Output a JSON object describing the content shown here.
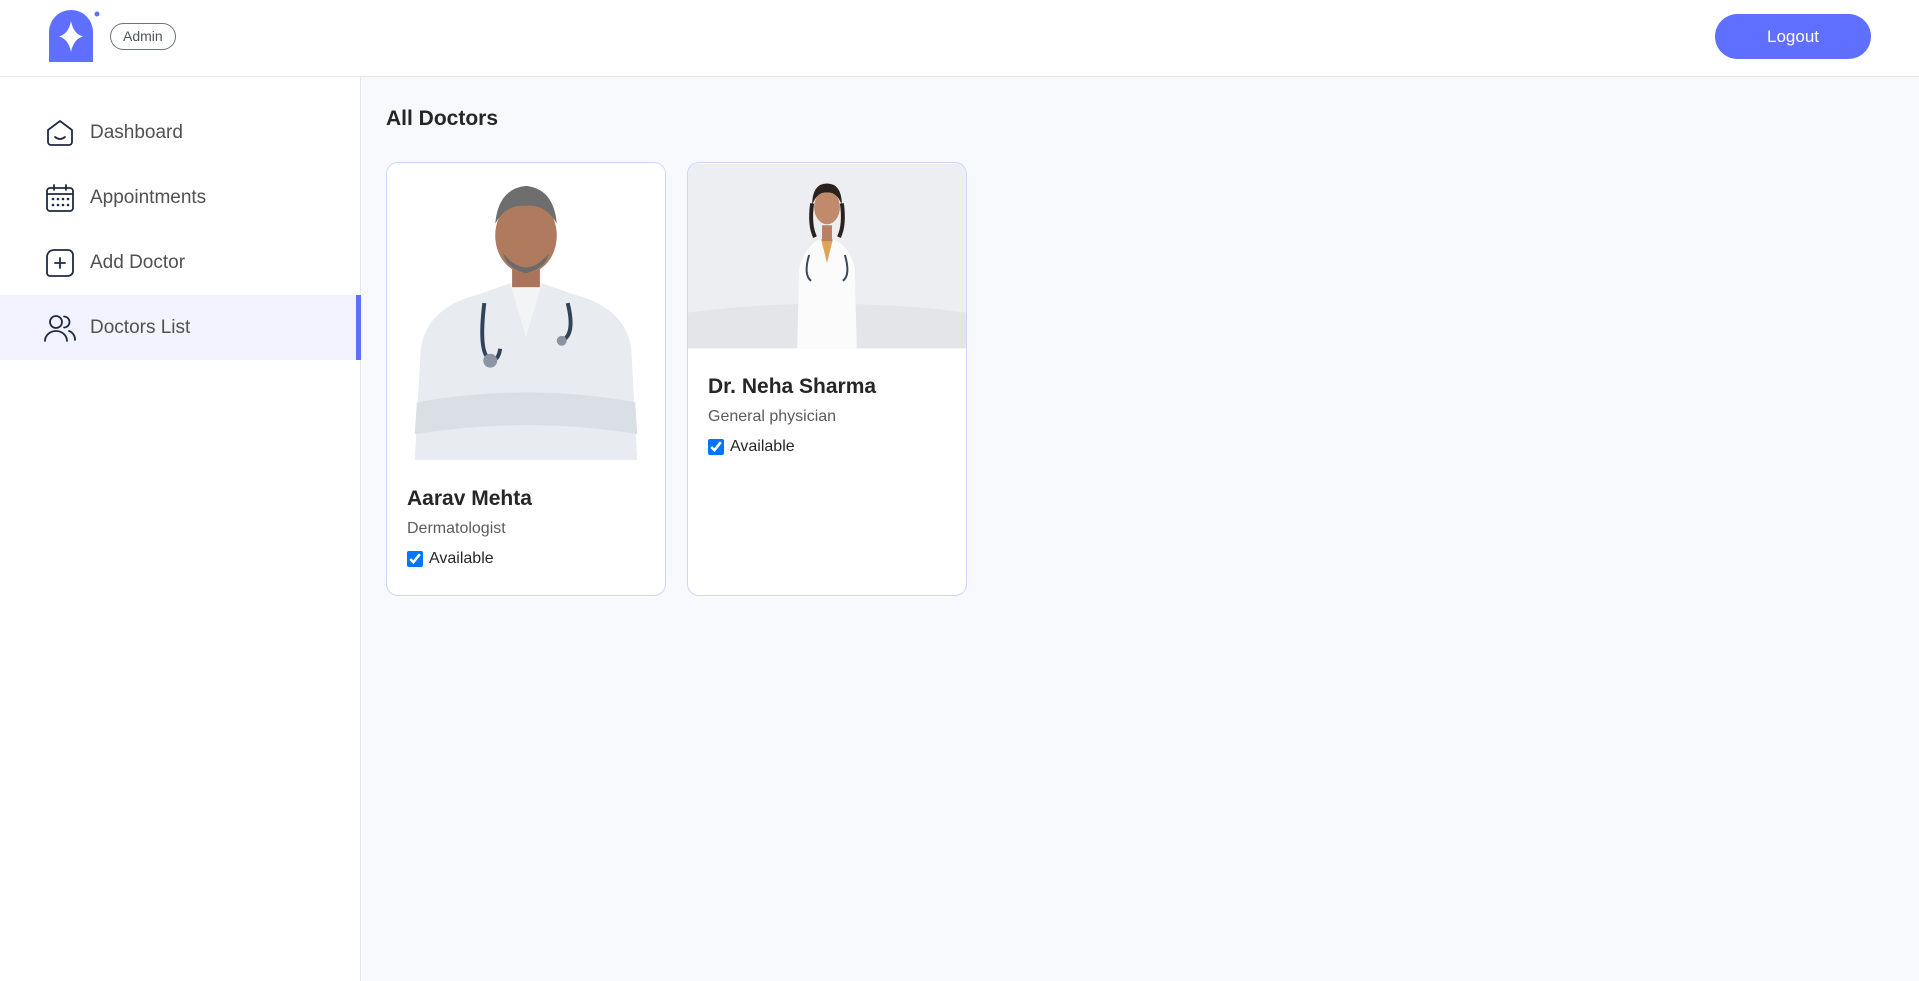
{
  "header": {
    "role_badge": "Admin",
    "logout_label": "Logout",
    "brand_color": "#5f6fff"
  },
  "sidebar": {
    "items": [
      {
        "label": "Dashboard",
        "icon": "home-icon",
        "active": false
      },
      {
        "label": "Appointments",
        "icon": "calendar-icon",
        "active": false
      },
      {
        "label": "Add Doctor",
        "icon": "add-icon",
        "active": false
      },
      {
        "label": "Doctors List",
        "icon": "people-icon",
        "active": true
      }
    ]
  },
  "main": {
    "title": "All Doctors",
    "doctors": [
      {
        "name": "Aarav Mehta",
        "speciality": "Dermatologist",
        "available": true,
        "availability_label": "Available"
      },
      {
        "name": "Dr. Neha Sharma",
        "speciality": "General physician",
        "available": true,
        "availability_label": "Available"
      }
    ]
  }
}
